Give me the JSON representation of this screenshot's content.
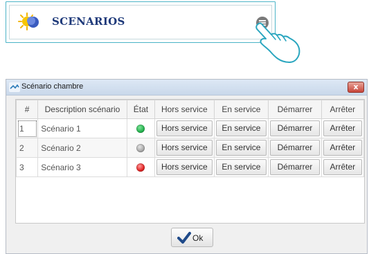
{
  "card": {
    "title": "SCENARIOS",
    "icon": "sun-moon-icon",
    "menu_icon": "menu-icon"
  },
  "window": {
    "title": "Scénario chambre",
    "close_label": "x",
    "columns": [
      "#",
      "Description scénario",
      "État",
      "Hors service",
      "En service",
      "Démarrer",
      "Arrêter"
    ],
    "rows": [
      {
        "num": "1",
        "description": "Scénario 1",
        "state_color": "#22b14c",
        "b1": "Hors service",
        "b2": "En service",
        "b3": "Démarrer",
        "b4": "Arrêter"
      },
      {
        "num": "2",
        "description": "Scénario 2",
        "state_color": "#a6a6a6",
        "b1": "Hors service",
        "b2": "En service",
        "b3": "Démarrer",
        "b4": "Arrêter"
      },
      {
        "num": "3",
        "description": "Scénario 3",
        "state_color": "#e02020",
        "b1": "Hors service",
        "b2": "En service",
        "b3": "Démarrer",
        "b4": "Arrêter"
      }
    ],
    "ok_label": "Ok"
  },
  "colors": {
    "accent": "#4ab3c7",
    "title_text": "#1f3a7a"
  }
}
